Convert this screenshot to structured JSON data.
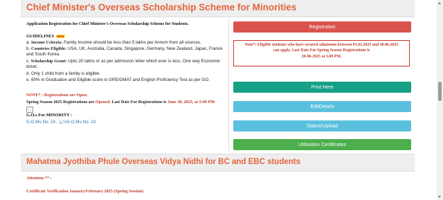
{
  "section1": {
    "title": "Chief Minister's Overseas Scholarship Scheme for Minorities",
    "intro": "Application Registration for Chief Minister's Overseas Scholarship Scheme for Students.",
    "guidelines_heading": "GUIDELINES",
    "new_badge": "NEW",
    "items": {
      "a_prefix": "a.",
      "a_label": "Income Criteria:",
      "a_text": "Family Income should be less than 5 lakhs per Annum from all sources.",
      "b_prefix": "b.",
      "b_label": "Countries Eligible:",
      "b_text": "USA, UK, Australia, Canada, Singapore, Germany, New Zealand, Japan, France and South Korea.",
      "c_prefix": "c.",
      "c_label": "Scholarship Grant:",
      "c_text": "Upto 20 lakhs or as per admission letter which ever is less, One way Economic ticket.",
      "d_text": "d. Only 1 child from a family is eligible.",
      "e_text": "e. 60% in Graduation and Eligible score in GRE/GMAT and English Proficiency Test as per GO."
    },
    "note": "NOTE* : Registrations are Open.",
    "spring": {
      "part1": "Spring Season 2025 Registrations are",
      "opened": "Opened.",
      "part2": "Last Date For Registrations is",
      "date": "June 30, 2025, at 5:00 PM"
    },
    "gos_heading": "G.O.s For MINORITY :",
    "go_link1": "G.O.Ms.No. 24",
    "go_sep": " , ",
    "go_link2": "ï¿½G.O.Ms.No. 23"
  },
  "right_panel": {
    "registration_button": "Registration",
    "alert": {
      "line1": "Note*: Eligible students who have secured admission between 01.01.2025 and 30.06.2025",
      "line2": "can apply. Last Date For Spring Season Registrations is",
      "line3": "30-06-2025 at 5.00 PM."
    },
    "print_button": "Print Here",
    "edit_button": "EditDetails",
    "status_button": "Status/Upload",
    "util_button": "Utilisation Certificates"
  },
  "section2": {
    "title": "Mahatma Jyothiba Phule Overseas Vidya Nidhi for BC and EBC students",
    "attention": "Attention ** :",
    "certificate": "Certificate Verification January/February 2025 (Spring Session)"
  },
  "colors": {
    "title": "#e3643c",
    "registration": "#d9534f",
    "print": "#16a085",
    "info": "#5bc0de",
    "success": "#4cae4c",
    "alert_text": "#c0392b"
  }
}
